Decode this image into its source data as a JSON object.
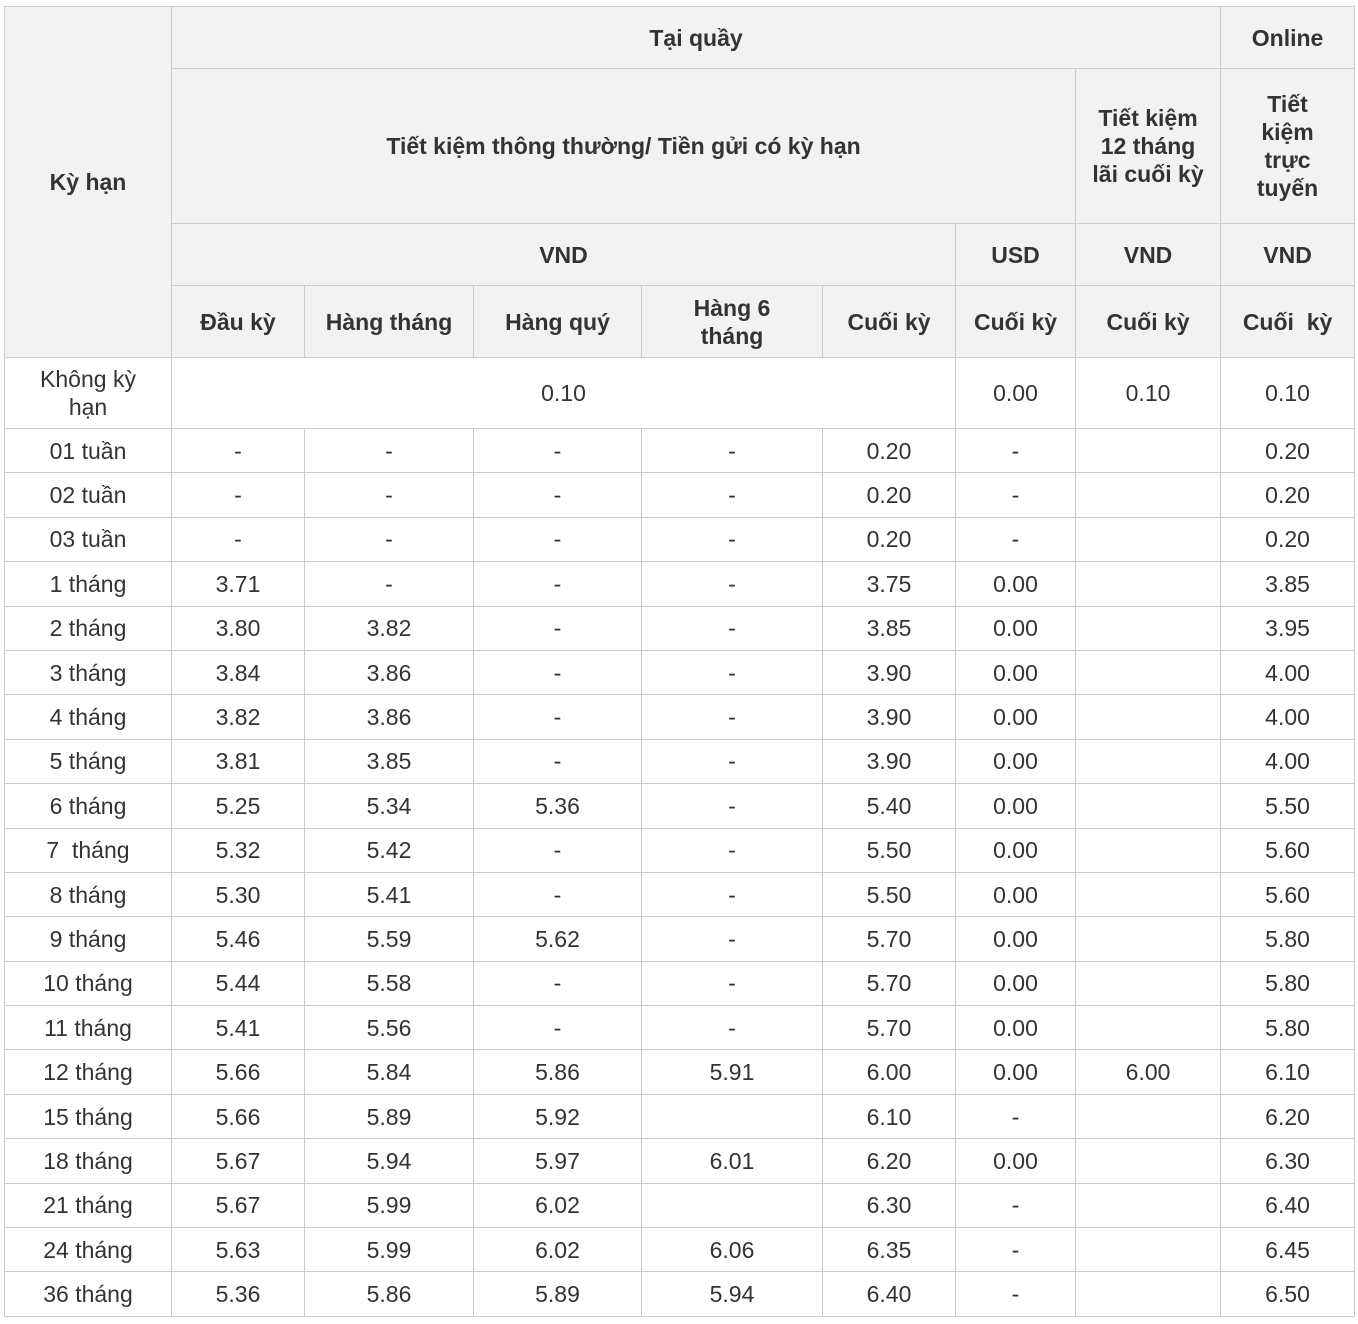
{
  "header": {
    "term": "Kỳ hạn",
    "counter": "Tại quầy",
    "online": "Online",
    "regular_savings": "Tiết kiệm thông thường/ Tiền gửi có kỳ hạn",
    "savings_12m": "Tiết kiệm 12 tháng lãi cuối kỳ",
    "online_savings": "Tiết kiệm trực tuyến",
    "vnd": "VND",
    "usd": "USD",
    "vnd_savings12": "VND",
    "vnd_online": "VND",
    "col_dau_ky": "Đầu kỳ",
    "col_hang_thang": "Hàng tháng",
    "col_hang_quy": "Hàng quý",
    "col_hang_6_thang": "Hàng 6 tháng",
    "col_cuoi_ky": "Cuối kỳ",
    "col_usd_cuoi_ky": "Cuối kỳ",
    "col_s12_cuoi_ky": "Cuối kỳ",
    "col_online_cuoi_ky": "Cuối  kỳ"
  },
  "first_row": {
    "term": "Không kỳ hạn",
    "vnd": "0.10",
    "usd": "0.00",
    "savings12": "0.10",
    "online": "0.10"
  },
  "rows": [
    {
      "term": "01 tuần",
      "dau_ky": "-",
      "hang_thang": "-",
      "hang_quy": "-",
      "hang_6_thang": "-",
      "cuoi_ky": "0.20",
      "usd": "-",
      "savings12": "",
      "online": "0.20"
    },
    {
      "term": "02 tuần",
      "dau_ky": "-",
      "hang_thang": "-",
      "hang_quy": "-",
      "hang_6_thang": "-",
      "cuoi_ky": "0.20",
      "usd": "-",
      "savings12": "",
      "online": "0.20"
    },
    {
      "term": "03 tuần",
      "dau_ky": "-",
      "hang_thang": "-",
      "hang_quy": "-",
      "hang_6_thang": "-",
      "cuoi_ky": "0.20",
      "usd": "-",
      "savings12": "",
      "online": "0.20"
    },
    {
      "term": "1 tháng",
      "dau_ky": "3.71",
      "hang_thang": "-",
      "hang_quy": "-",
      "hang_6_thang": "-",
      "cuoi_ky": "3.75",
      "usd": "0.00",
      "savings12": "",
      "online": "3.85"
    },
    {
      "term": "2 tháng",
      "dau_ky": "3.80",
      "hang_thang": "3.82",
      "hang_quy": "-",
      "hang_6_thang": "-",
      "cuoi_ky": "3.85",
      "usd": "0.00",
      "savings12": "",
      "online": "3.95"
    },
    {
      "term": "3 tháng",
      "dau_ky": "3.84",
      "hang_thang": "3.86",
      "hang_quy": "-",
      "hang_6_thang": "-",
      "cuoi_ky": "3.90",
      "usd": "0.00",
      "savings12": "",
      "online": "4.00"
    },
    {
      "term": "4 tháng",
      "dau_ky": "3.82",
      "hang_thang": "3.86",
      "hang_quy": "-",
      "hang_6_thang": "-",
      "cuoi_ky": "3.90",
      "usd": "0.00",
      "savings12": "",
      "online": "4.00"
    },
    {
      "term": "5 tháng",
      "dau_ky": "3.81",
      "hang_thang": "3.85",
      "hang_quy": "-",
      "hang_6_thang": "-",
      "cuoi_ky": "3.90",
      "usd": "0.00",
      "savings12": "",
      "online": "4.00"
    },
    {
      "term": "6 tháng",
      "dau_ky": "5.25",
      "hang_thang": "5.34",
      "hang_quy": "5.36",
      "hang_6_thang": "-",
      "cuoi_ky": "5.40",
      "usd": "0.00",
      "savings12": "",
      "online": "5.50"
    },
    {
      "term": "7  tháng",
      "dau_ky": "5.32",
      "hang_thang": "5.42",
      "hang_quy": "-",
      "hang_6_thang": "-",
      "cuoi_ky": "5.50",
      "usd": "0.00",
      "savings12": "",
      "online": "5.60"
    },
    {
      "term": "8 tháng",
      "dau_ky": "5.30",
      "hang_thang": "5.41",
      "hang_quy": "-",
      "hang_6_thang": "-",
      "cuoi_ky": "5.50",
      "usd": "0.00",
      "savings12": "",
      "online": "5.60"
    },
    {
      "term": "9 tháng",
      "dau_ky": "5.46",
      "hang_thang": "5.59",
      "hang_quy": "5.62",
      "hang_6_thang": "-",
      "cuoi_ky": "5.70",
      "usd": "0.00",
      "savings12": "",
      "online": "5.80"
    },
    {
      "term": "10 tháng",
      "dau_ky": "5.44",
      "hang_thang": "5.58",
      "hang_quy": "-",
      "hang_6_thang": "-",
      "cuoi_ky": "5.70",
      "usd": "0.00",
      "savings12": "",
      "online": "5.80"
    },
    {
      "term": "11 tháng",
      "dau_ky": "5.41",
      "hang_thang": "5.56",
      "hang_quy": "-",
      "hang_6_thang": "-",
      "cuoi_ky": "5.70",
      "usd": "0.00",
      "savings12": "",
      "online": "5.80"
    },
    {
      "term": "12 tháng",
      "dau_ky": "5.66",
      "hang_thang": "5.84",
      "hang_quy": "5.86",
      "hang_6_thang": "5.91",
      "cuoi_ky": "6.00",
      "usd": "0.00",
      "savings12": "6.00",
      "online": "6.10"
    },
    {
      "term": "15 tháng",
      "dau_ky": "5.66",
      "hang_thang": "5.89",
      "hang_quy": "5.92",
      "hang_6_thang": "",
      "cuoi_ky": "6.10",
      "usd": "-",
      "savings12": "",
      "online": "6.20"
    },
    {
      "term": "18 tháng",
      "dau_ky": "5.67",
      "hang_thang": "5.94",
      "hang_quy": "5.97",
      "hang_6_thang": "6.01",
      "cuoi_ky": "6.20",
      "usd": "0.00",
      "savings12": "",
      "online": "6.30"
    },
    {
      "term": "21 tháng",
      "dau_ky": "5.67",
      "hang_thang": "5.99",
      "hang_quy": "6.02",
      "hang_6_thang": "",
      "cuoi_ky": "6.30",
      "usd": "-",
      "savings12": "",
      "online": "6.40"
    },
    {
      "term": "24 tháng",
      "dau_ky": "5.63",
      "hang_thang": "5.99",
      "hang_quy": "6.02",
      "hang_6_thang": "6.06",
      "cuoi_ky": "6.35",
      "usd": "-",
      "savings12": "",
      "online": "6.45"
    },
    {
      "term": "36 tháng",
      "dau_ky": "5.36",
      "hang_thang": "5.86",
      "hang_quy": "5.89",
      "hang_6_thang": "5.94",
      "cuoi_ky": "6.40",
      "usd": "-",
      "savings12": "",
      "online": "6.50"
    }
  ]
}
